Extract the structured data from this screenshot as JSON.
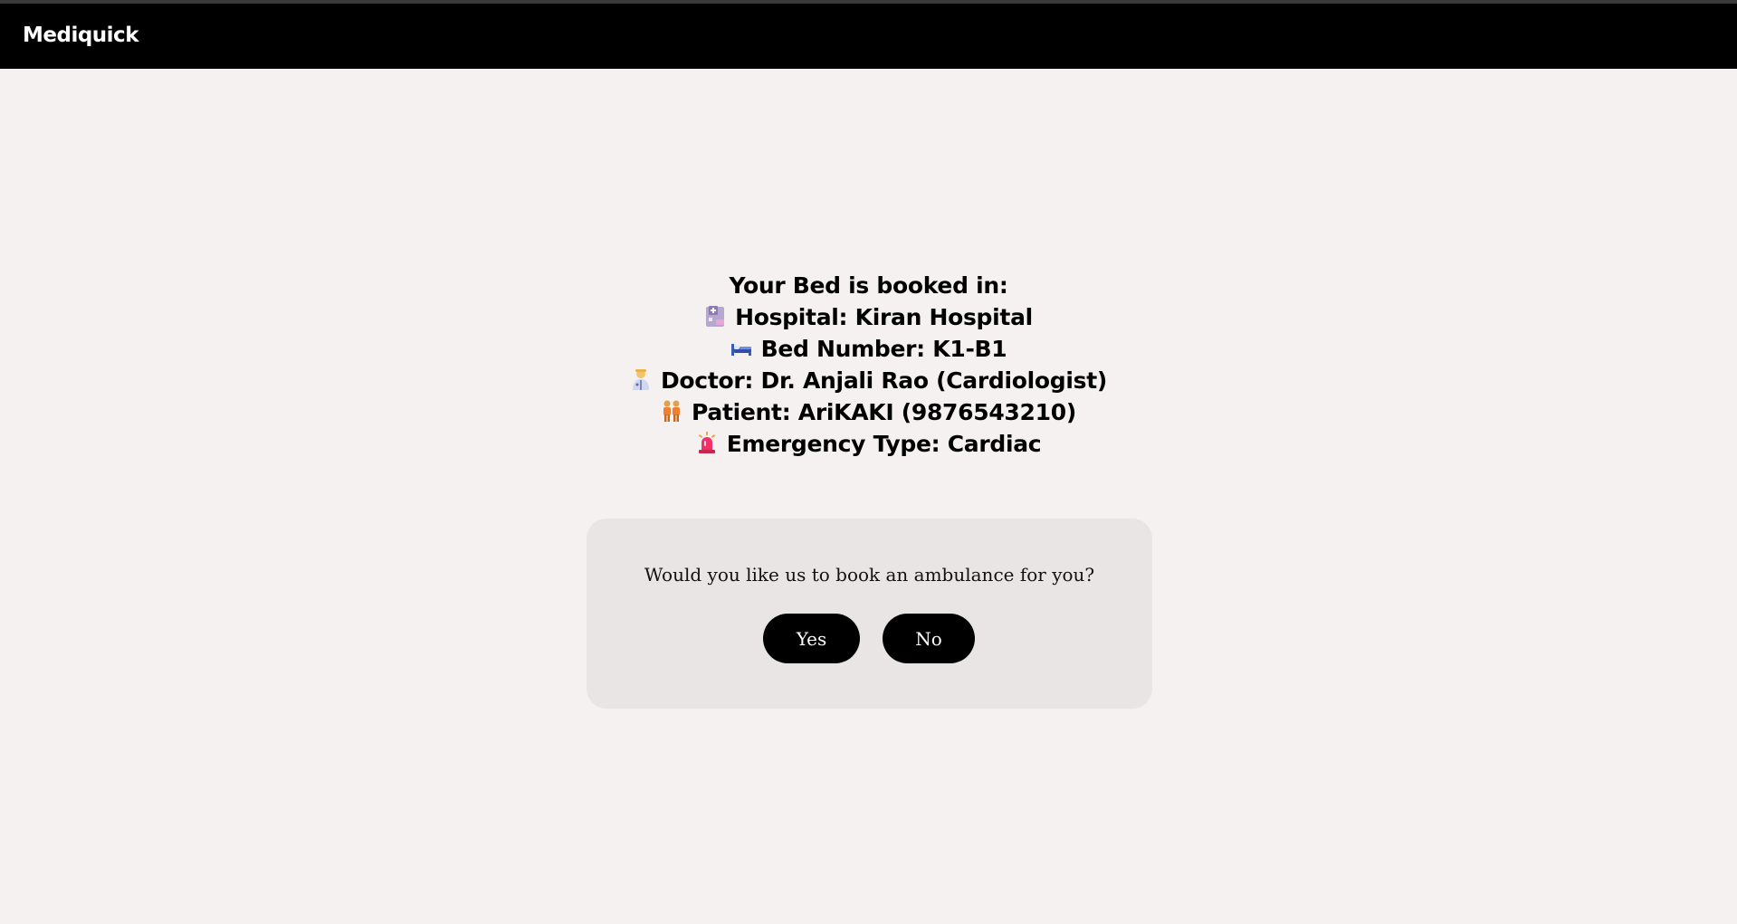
{
  "header": {
    "brand": "Mediquick"
  },
  "booking": {
    "title": "Your Bed is booked in:",
    "hospital": "Hospital: Kiran Hospital",
    "bed": "Bed Number: K1-B1",
    "doctor": "Doctor: Dr. Anjali Rao (Cardiologist)",
    "patient": "Patient: AriKAKI (9876543210)",
    "emergency": "Emergency Type: Cardiac",
    "icons": [
      "hospital-icon",
      "bed-icon",
      "doctor-icon",
      "patient-icon",
      "siren-icon"
    ]
  },
  "ambulance_prompt": {
    "question": "Would you like us to book an ambulance for you?",
    "yes_label": "Yes",
    "no_label": "No"
  },
  "colors": {
    "background": "#f5f1f0",
    "navbar": "#000000",
    "card": "#e9e5e4",
    "button": "#000000"
  }
}
